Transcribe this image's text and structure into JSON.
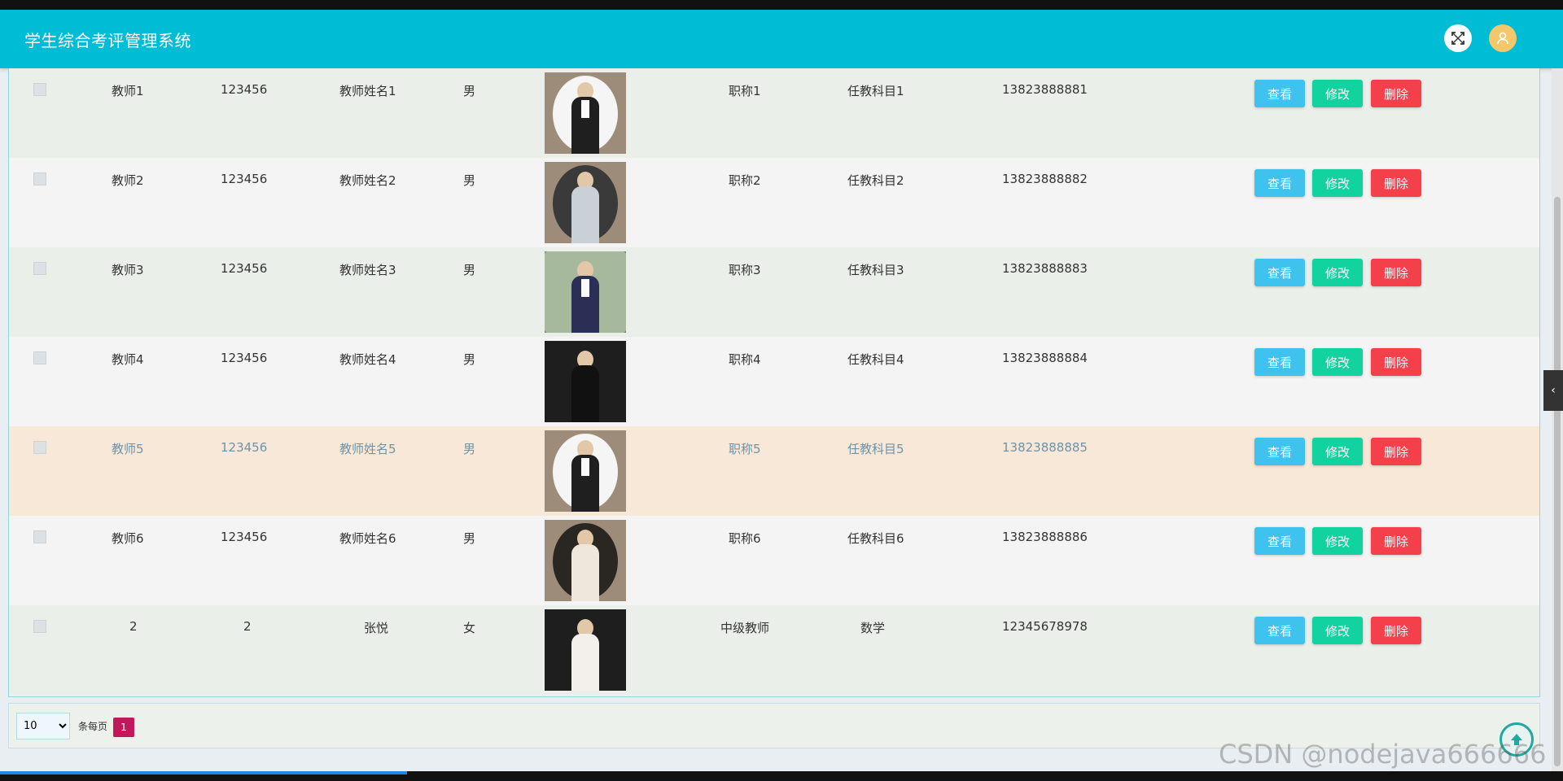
{
  "app": {
    "title": "学生综合考评管理系统"
  },
  "header": {
    "fullscreen_icon": "expand-icon",
    "user_icon": "user-icon"
  },
  "colors": {
    "header": "#00bcd4",
    "view": "#3fc2ed",
    "edit": "#12d3a0",
    "delete": "#f3404b",
    "page_active": "#c2185b"
  },
  "actions": {
    "view": "查看",
    "edit": "修改",
    "delete": "删除"
  },
  "rows": [
    {
      "account": "教师1",
      "password": "123456",
      "name": "教师姓名1",
      "gender": "男",
      "title": "职称1",
      "subject": "任教科目1",
      "phone": "13823888881"
    },
    {
      "account": "教师2",
      "password": "123456",
      "name": "教师姓名2",
      "gender": "男",
      "title": "职称2",
      "subject": "任教科目2",
      "phone": "13823888882"
    },
    {
      "account": "教师3",
      "password": "123456",
      "name": "教师姓名3",
      "gender": "男",
      "title": "职称3",
      "subject": "任教科目3",
      "phone": "13823888883"
    },
    {
      "account": "教师4",
      "password": "123456",
      "name": "教师姓名4",
      "gender": "男",
      "title": "职称4",
      "subject": "任教科目4",
      "phone": "13823888884"
    },
    {
      "account": "教师5",
      "password": "123456",
      "name": "教师姓名5",
      "gender": "男",
      "title": "职称5",
      "subject": "任教科目5",
      "phone": "13823888885"
    },
    {
      "account": "教师6",
      "password": "123456",
      "name": "教师姓名6",
      "gender": "男",
      "title": "职称6",
      "subject": "任教科目6",
      "phone": "13823888886"
    },
    {
      "account": "2",
      "password": "2",
      "name": "张悦",
      "gender": "女",
      "title": "中级教师",
      "subject": "数学",
      "phone": "12345678978"
    }
  ],
  "pager": {
    "page_size": "10",
    "per_page_label": "条每页",
    "current_page": "1"
  },
  "watermark": "CSDN @nodejava666666"
}
